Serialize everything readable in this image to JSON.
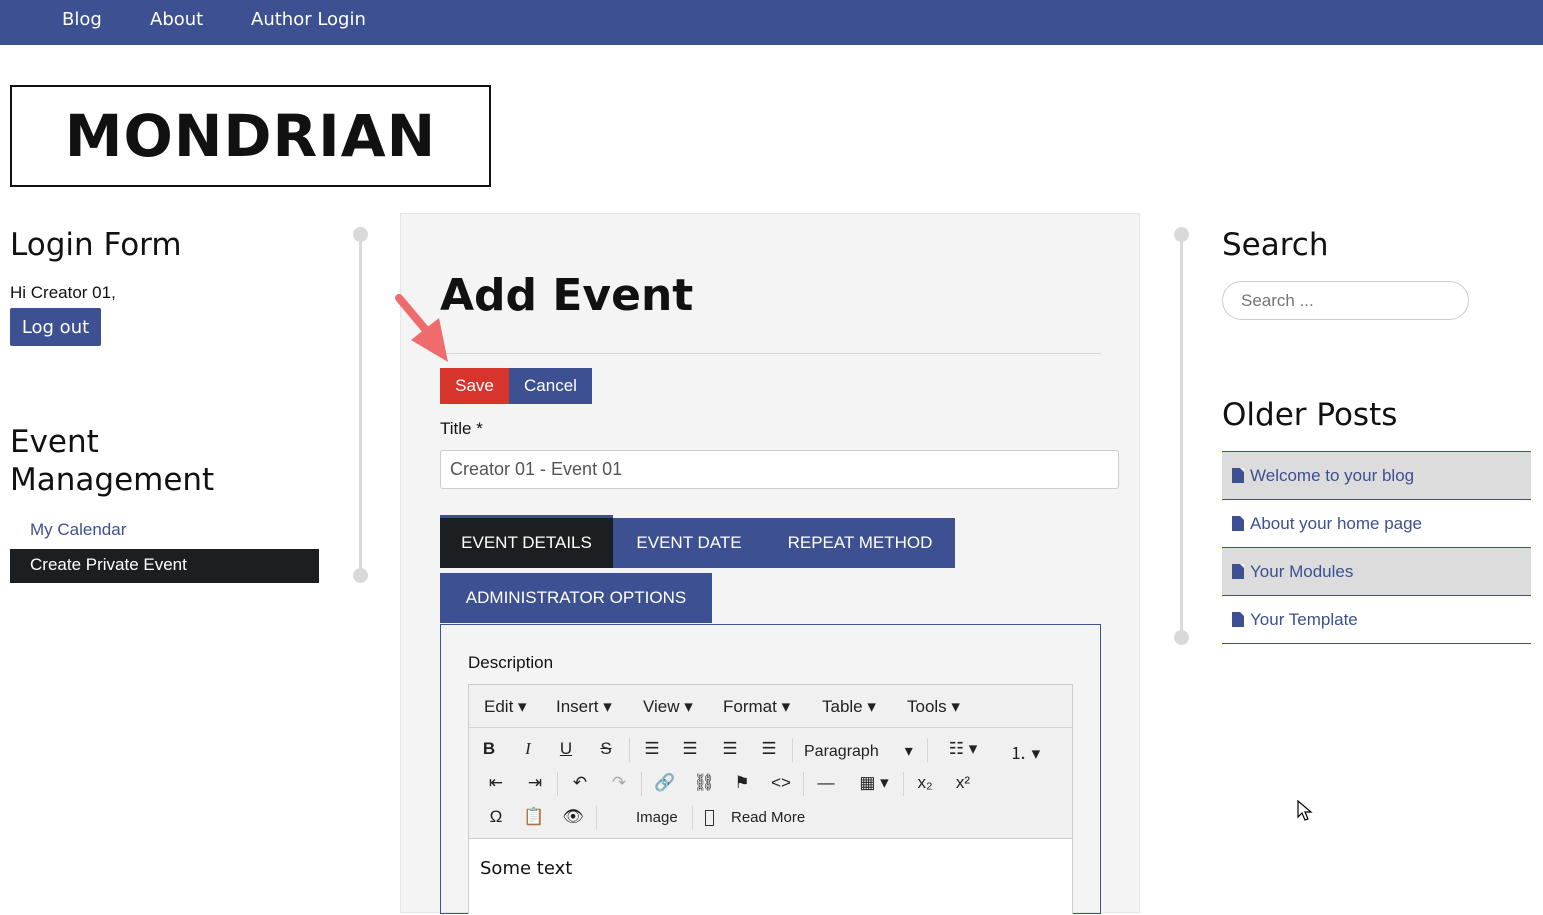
{
  "nav": {
    "items": [
      "Blog",
      "About",
      "Author Login"
    ]
  },
  "logo": {
    "text": "MONDRIAN"
  },
  "left": {
    "login_title": "Login Form",
    "greeting": "Hi Creator 01,",
    "logout_label": "Log out",
    "event_title_line1": "Event",
    "event_title_line2": "Management",
    "menu": [
      "My Calendar",
      "Create Private Event"
    ]
  },
  "main": {
    "title": "Add Event",
    "save_label": "Save",
    "cancel_label": "Cancel",
    "title_label": "Title *",
    "title_value": "Creator 01 - Event 01",
    "tabs": [
      "EVENT DETAILS",
      "EVENT DATE",
      "REPEAT METHOD",
      "ADMINISTRATOR OPTIONS"
    ],
    "description_label": "Description",
    "editor_menu": [
      "Edit",
      "Insert",
      "View",
      "Format",
      "Table",
      "Tools"
    ],
    "paragraph_label": "Paragraph",
    "image_label": "Image",
    "readmore_label": "Read More",
    "body_text": "Some text"
  },
  "right": {
    "search_title": "Search",
    "search_placeholder": "Search ...",
    "older_title": "Older Posts",
    "posts": [
      "Welcome to your blog",
      "About your home page",
      "Your Modules",
      "Your Template"
    ]
  },
  "colors": {
    "brand": "#3d5091",
    "save": "#d7342b",
    "active_tab": "#1c1f22"
  }
}
